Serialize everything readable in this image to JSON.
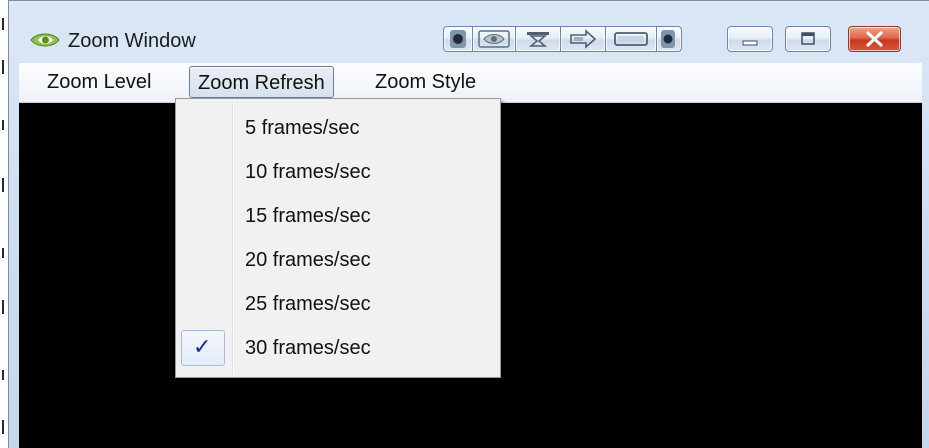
{
  "window": {
    "title": "Zoom Window"
  },
  "icons": {
    "app": "nvidia-eye-icon",
    "tools": [
      "record-icon",
      "eye-icon",
      "pin-top-icon",
      "export-arrow-icon",
      "window-frame-icon",
      "dot-icon"
    ],
    "minimize": "minimize-icon",
    "maximize": "maximize-icon",
    "close": "close-icon"
  },
  "menubar": {
    "items": [
      {
        "label": "Zoom Level"
      },
      {
        "label": "Zoom Refresh"
      },
      {
        "label": "Zoom Style"
      }
    ],
    "active_index": 1
  },
  "dropdown": {
    "items": [
      {
        "label": "5 frames/sec",
        "checked": false
      },
      {
        "label": "10 frames/sec",
        "checked": false
      },
      {
        "label": "15 frames/sec",
        "checked": false
      },
      {
        "label": "20 frames/sec",
        "checked": false
      },
      {
        "label": "25 frames/sec",
        "checked": false
      },
      {
        "label": "30 frames/sec",
        "checked": true
      }
    ],
    "check_glyph": "✓"
  },
  "colors": {
    "titlebar": "#cfdff1",
    "close_button": "#d9583c",
    "client_area": "#000000",
    "check_mark": "#1d2a9a"
  }
}
